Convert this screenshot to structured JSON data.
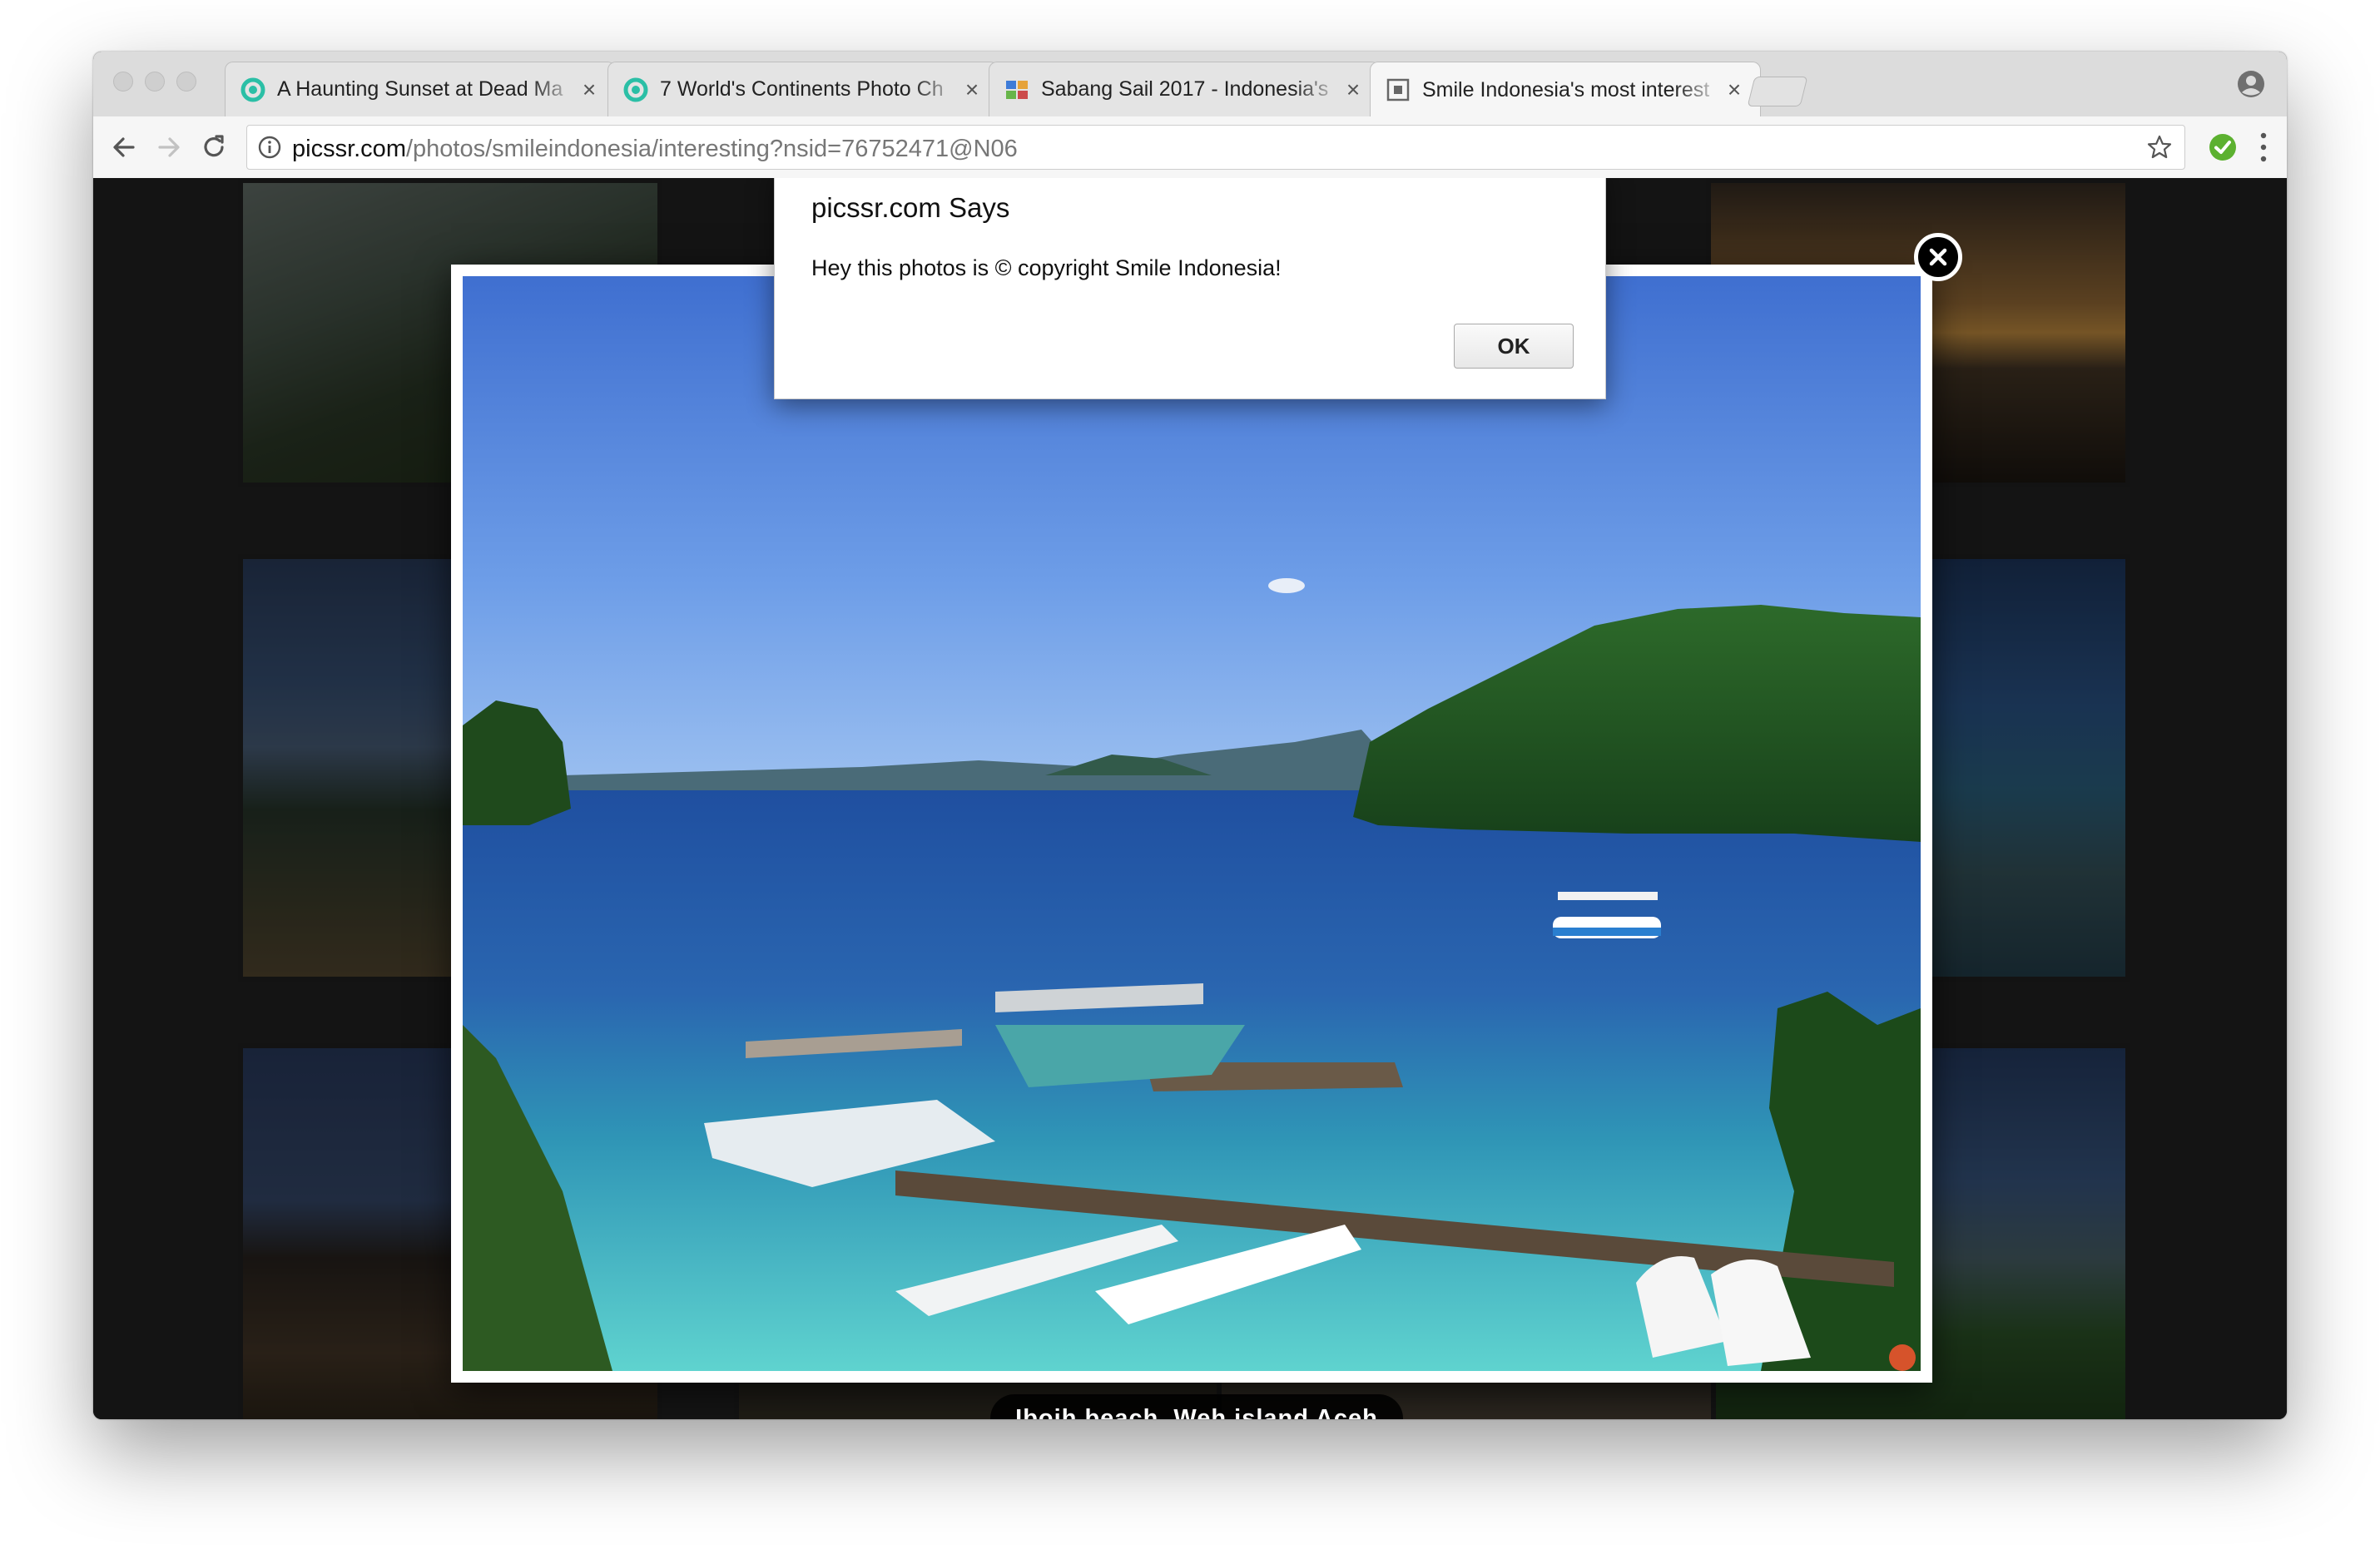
{
  "browser": {
    "tabs": [
      {
        "title": "A Haunting Sunset at Dead Ma",
        "favicon": "picssr-icon",
        "active": false
      },
      {
        "title": "7 World's Continents Photo Ch",
        "favicon": "picssr-icon",
        "active": false
      },
      {
        "title": "Sabang Sail 2017 - Indonesia's",
        "favicon": "image-icon",
        "active": false
      },
      {
        "title": "Smile Indonesia's most interest",
        "favicon": "page-icon",
        "active": true
      }
    ],
    "close_glyph": "×",
    "url_host": "picssr.com",
    "url_path": "/photos/smileindonesia/interesting?nsid=76752471@N06"
  },
  "lightbox": {
    "caption": "Iboih beach, Weh island Aceh",
    "close_glyph": "×"
  },
  "dialog": {
    "title": "picssr.com Says",
    "message": "Hey this photos is © copyright Smile Indonesia!",
    "ok_label": "OK"
  },
  "colors": {
    "accent_green": "#5cb130",
    "page_background": "#141414",
    "tab_strip": "#dcdcdc"
  }
}
